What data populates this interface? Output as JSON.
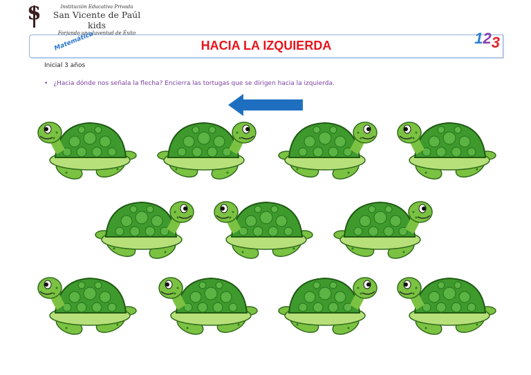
{
  "header": {
    "institution_line1": "Institución Educativa Privada",
    "institution_name": "San Vicente de Paúl kids",
    "motto": "Forjando una Juventud de Éxito",
    "logo_letters": "SVP"
  },
  "banner": {
    "subject": "Matemática",
    "title": "HACIA LA IZQUIERDA",
    "numbers": [
      "1",
      "2",
      "3"
    ]
  },
  "level": "Inicial 3 años",
  "instruction": "¿Hacia dónde nos señala la flecha? Encierra las tortugas que se dirigen hacia la izquierda.",
  "arrow": {
    "direction": "left",
    "color": "#1f6fc0"
  },
  "turtles": [
    {
      "row": 1,
      "facing": "left"
    },
    {
      "row": 1,
      "facing": "right"
    },
    {
      "row": 1,
      "facing": "right"
    },
    {
      "row": 1,
      "facing": "left"
    },
    {
      "row": 2,
      "facing": "right"
    },
    {
      "row": 2,
      "facing": "left"
    },
    {
      "row": 2,
      "facing": "right"
    },
    {
      "row": 3,
      "facing": "left"
    },
    {
      "row": 3,
      "facing": "left"
    },
    {
      "row": 3,
      "facing": "right"
    },
    {
      "row": 3,
      "facing": "left"
    }
  ]
}
